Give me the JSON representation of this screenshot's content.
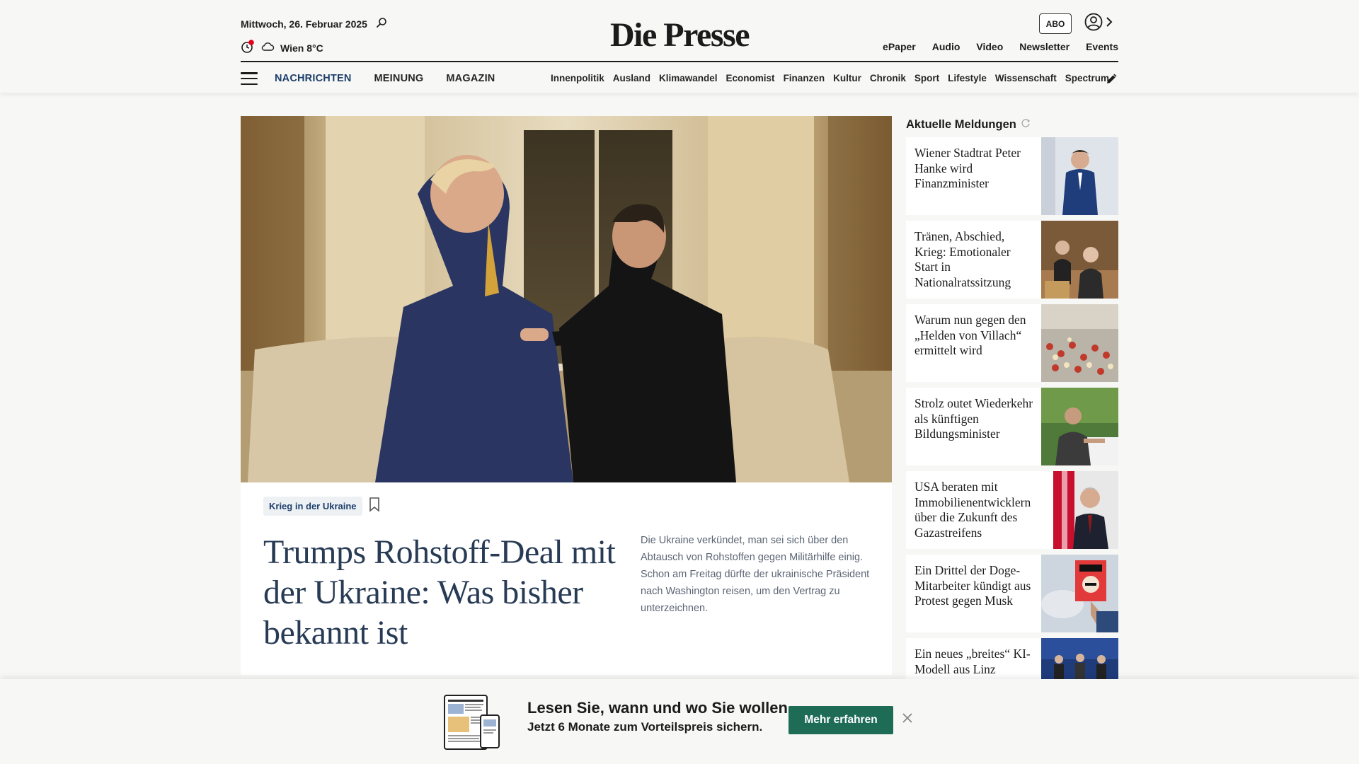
{
  "header": {
    "date": "Mittwoch, 26. Februar 2025",
    "weather": "Wien 8°C",
    "logo": "Die Presse",
    "abo_label": "ABO",
    "top_links": [
      "ePaper",
      "Audio",
      "Video",
      "Newsletter",
      "Events"
    ]
  },
  "nav": {
    "primary": [
      "NACHRICHTEN",
      "MEINUNG",
      "MAGAZIN"
    ],
    "sections": [
      "Innenpolitik",
      "Ausland",
      "Klimawandel",
      "Economist",
      "Finanzen",
      "Kultur",
      "Chronik",
      "Sport",
      "Lifestyle",
      "Wissenschaft",
      "Spectrum"
    ]
  },
  "hero": {
    "tag": "Krieg in der Ukraine",
    "headline": "Trumps Rohstoff-Deal mit der Ukraine: Was bisher bekannt ist",
    "teaser": "Die Ukraine verkündet, man sei sich über den Abtausch von Rohstoffen gegen Militärhilfe einig. Schon am Freitag dürfte der ukrainische Präsident nach Washington reisen, um den Vertrag zu unterzeichnen."
  },
  "sidebar": {
    "title": "Aktuelle Meldungen",
    "items": [
      {
        "title": "Wiener Stadtrat Peter Hanke wird Finanzminister"
      },
      {
        "title": "Tränen, Abschied, Krieg: Emotionaler Start in Nationalratssitzung"
      },
      {
        "title": "Warum nun gegen den „Helden von Villach“ ermittelt wird"
      },
      {
        "title": "Strolz outet Wiederkehr als künftigen Bildungsminister"
      },
      {
        "title": "USA beraten mit Immobilienentwicklern über die Zukunft des Gazastreifens"
      },
      {
        "title": "Ein Drittel der Doge-Mitarbeiter kündigt aus Protest gegen Musk"
      },
      {
        "title": "Ein neues „breites“ KI-Modell aus Linz"
      }
    ]
  },
  "promo": {
    "line1": "Lesen Sie, wann und wo Sie wollen.",
    "line2": "Jetzt 6 Monate zum Vorteilspreis sichern.",
    "button": "Mehr erfahren"
  },
  "colors": {
    "accent_blue": "#1c3e6b",
    "headline_blue": "#283b55",
    "promo_green": "#1e6b56",
    "live_dot": "#e2001a"
  },
  "icons": [
    "search-icon",
    "clock-live-icon",
    "cloud-icon",
    "user-icon",
    "chevron-right-icon",
    "menu-icon",
    "pencil-icon",
    "bookmark-icon",
    "refresh-icon",
    "close-icon"
  ]
}
